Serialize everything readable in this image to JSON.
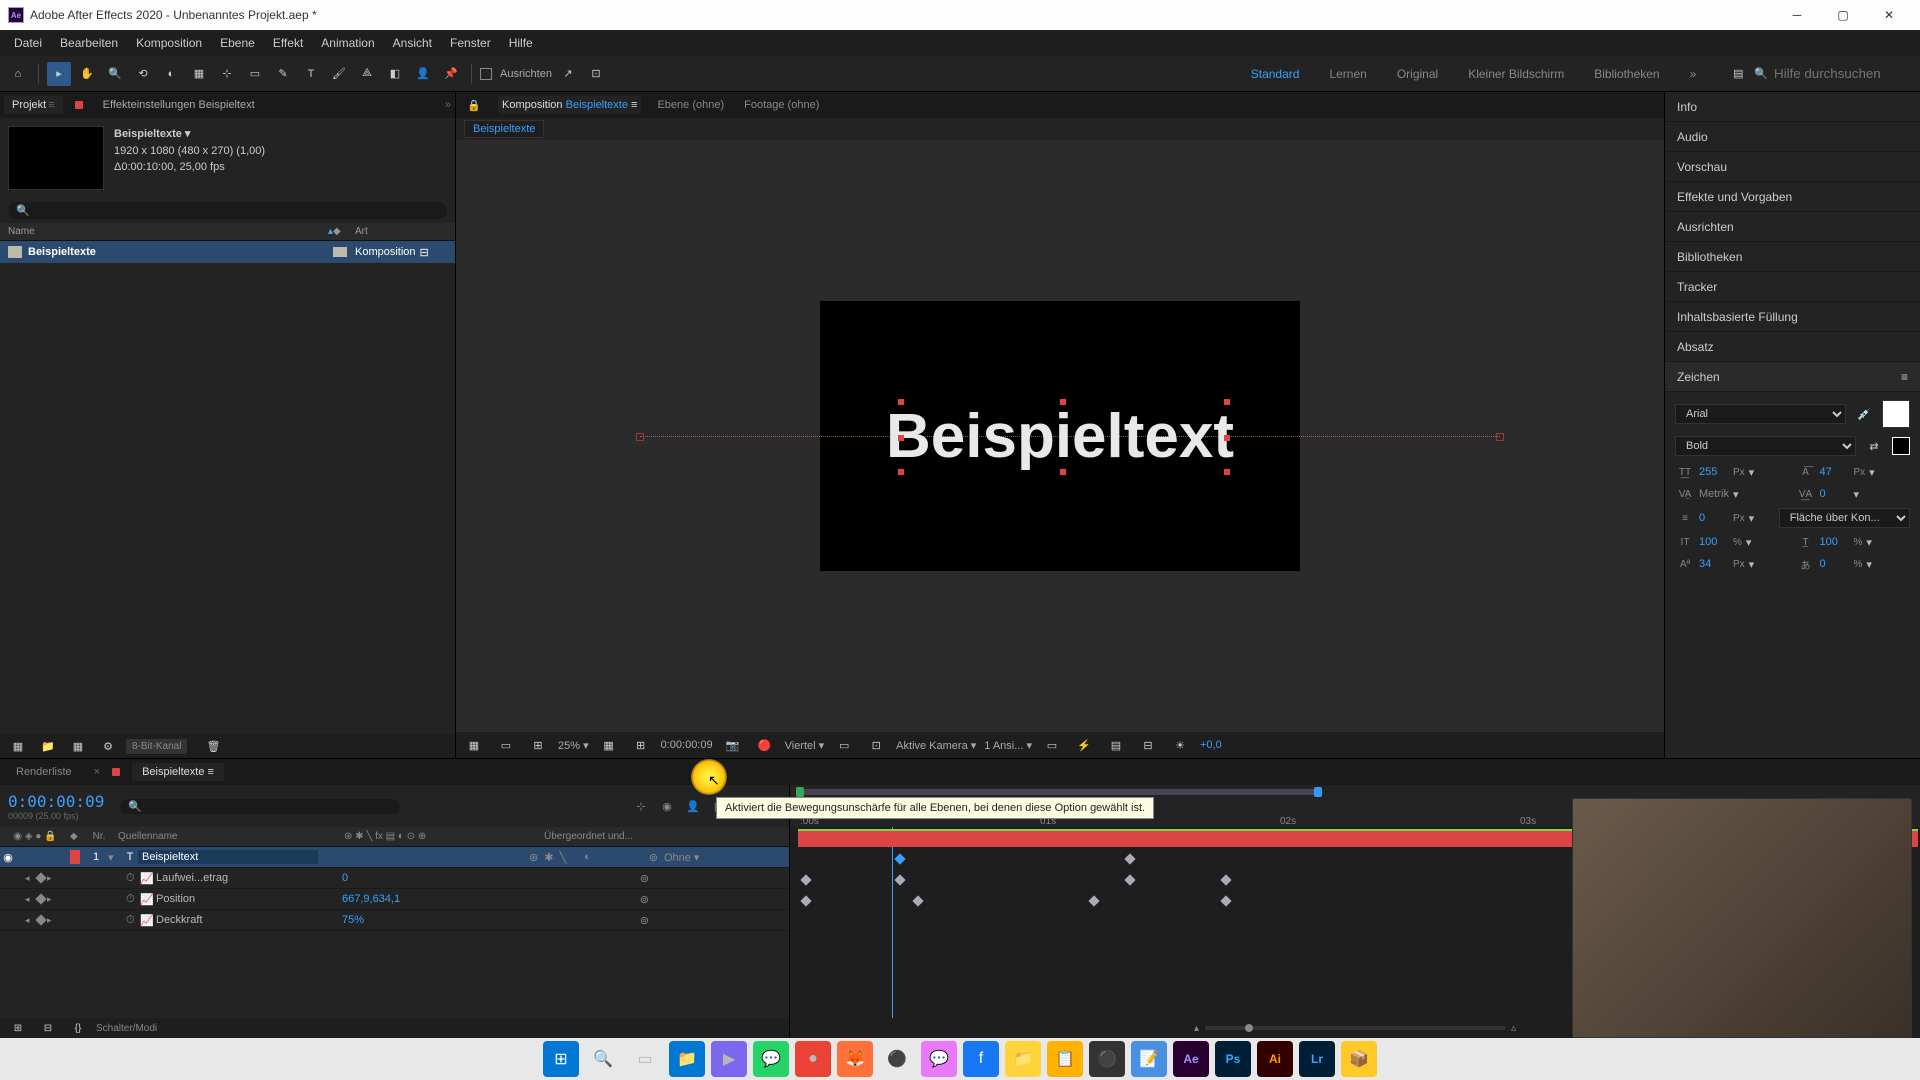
{
  "titlebar": {
    "app": "Adobe After Effects 2020",
    "project": "Unbenanntes Projekt.aep *"
  },
  "menu": [
    "Datei",
    "Bearbeiten",
    "Komposition",
    "Ebene",
    "Effekt",
    "Animation",
    "Ansicht",
    "Fenster",
    "Hilfe"
  ],
  "toolbar": {
    "align": "Ausrichten",
    "search_help": "Hilfe durchsuchen"
  },
  "workspaces": [
    "Standard",
    "Lernen",
    "Original",
    "Kleiner Bildschirm",
    "Bibliotheken"
  ],
  "project": {
    "tab": "Projekt",
    "settings_tab": "Effekteinstellungen Beispieltext",
    "comp_name": "Beispieltexte",
    "comp_dims": "1920 x 1080 (480 x 270) (1,00)",
    "comp_dur": "Δ0:00:10:00, 25,00 fps",
    "col_name": "Name",
    "col_type": "Art",
    "item_name": "Beispieltexte",
    "item_type": "Komposition",
    "bit_depth": "8-Bit-Kanal"
  },
  "comp_panel": {
    "tab_comp": "Komposition",
    "tab_comp_name": "Beispieltexte",
    "tab_layer": "Ebene (ohne)",
    "tab_footage": "Footage (ohne)",
    "subtab": "Beispieltexte",
    "sample_text": "Beispieltext",
    "footer": {
      "zoom": "25%",
      "time": "0:00:00:09",
      "res": "Viertel",
      "camera": "Aktive Kamera",
      "views": "1 Ansi...",
      "exposure": "+0,0"
    }
  },
  "right_panels": [
    "Info",
    "Audio",
    "Vorschau",
    "Effekte und Vorgaben",
    "Ausrichten",
    "Bibliotheken",
    "Tracker",
    "Inhaltsbasierte Füllung",
    "Absatz",
    "Zeichen"
  ],
  "char": {
    "font": "Arial",
    "weight": "Bold",
    "size": "255",
    "size_u": "Px",
    "leading": "47",
    "leading_u": "Px",
    "kerning": "Metrik",
    "tracking": "0",
    "stroke": "0",
    "stroke_u": "Px",
    "fill_over": "Fläche über Kon...",
    "vscale": "100",
    "vscale_u": "%",
    "hscale": "100",
    "hscale_u": "%",
    "baseline": "34",
    "baseline_u": "Px",
    "tsume": "0",
    "tsume_u": "%"
  },
  "timeline": {
    "render_tab": "Renderliste",
    "comp_tab": "Beispieltexte",
    "timecode": "0:00:00:09",
    "frames": "00009 (25.00 fps)",
    "col_nr": "Nr.",
    "col_src": "Quellenname",
    "col_parent": "Übergeordnet und...",
    "layer": {
      "nr": "1",
      "name": "Beispieltext",
      "parent": "Ohne"
    },
    "prop1": "Laufwei...etrag",
    "prop1_val": "0",
    "prop2": "Position",
    "prop2_val": "667,9,634,1",
    "prop3": "Deckkraft",
    "prop3_val": "75%",
    "marks": [
      ":00s",
      "01s",
      "02s",
      "03s"
    ],
    "switches": "Schalter/Modi"
  },
  "tooltip": "Aktiviert die Bewegungsunschärfe für alle Ebenen, bei denen diese Option gewählt ist."
}
